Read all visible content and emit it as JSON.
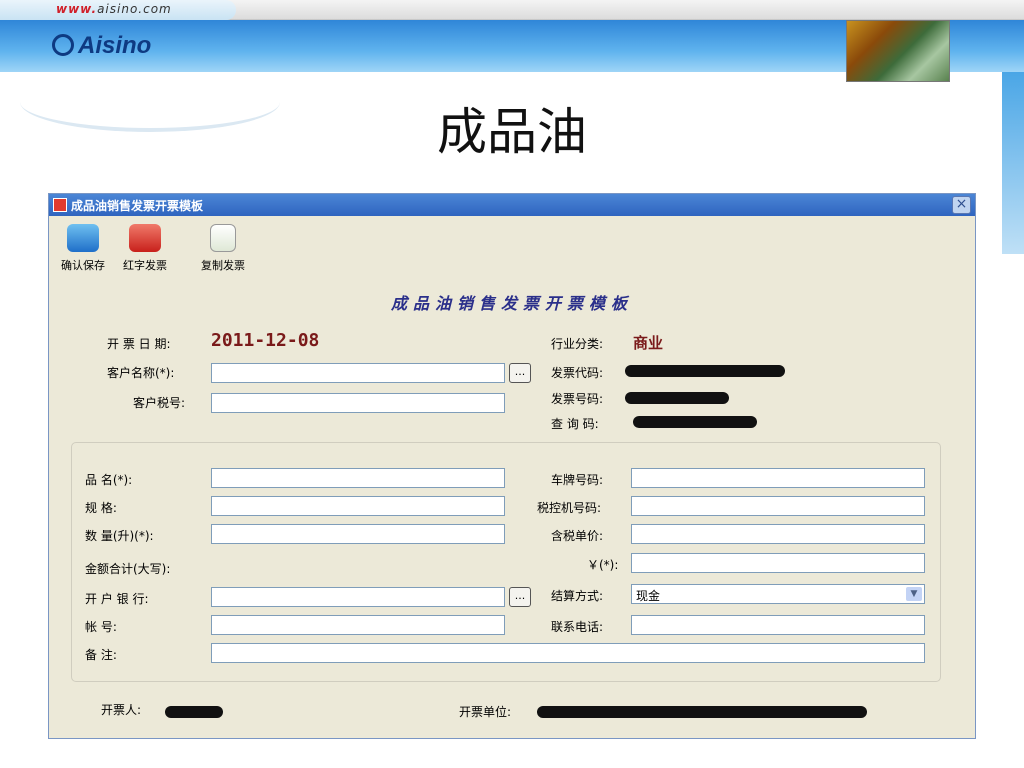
{
  "header": {
    "url_prefix": "www.",
    "url_rest": "aisino.com",
    "logo_text": "Aisino",
    "page_title": "成品油"
  },
  "window": {
    "title": "成品油销售发票开票模板",
    "close_glyph": "×"
  },
  "toolbar": {
    "save_label": "确认保存",
    "red_invoice_label": "红字发票",
    "copy_invoice_label": "复制发票"
  },
  "form": {
    "title": "成品油销售发票开票模板",
    "date_label": "开 票 日 期:",
    "date_value": "2011-12-08",
    "industry_label": "行业分类:",
    "industry_value": "商业",
    "customer_name_label": "客户名称(*):",
    "customer_name_value": "",
    "customer_tax_label": "客户税号:",
    "customer_tax_value": "",
    "invoice_code_label": "发票代码:",
    "invoice_number_label": "发票号码:",
    "query_code_label": "查 询 码:",
    "product_name_label": "品      名(*):",
    "product_name_value": "",
    "spec_label": "规          格:",
    "spec_value": "",
    "quantity_label": "数   量(升)(*):",
    "quantity_value": "",
    "amount_words_label": "金额合计(大写):",
    "bank_label": "开  户  银  行:",
    "bank_value": "",
    "account_label": "帐          号:",
    "account_value": "",
    "remark_label": "备          注:",
    "remark_value": "",
    "plate_label": "车牌号码:",
    "plate_value": "",
    "tax_machine_label": "税控机号码:",
    "tax_machine_value": "",
    "unit_price_label": "含税单价:",
    "unit_price_value": "",
    "yuan_label": "￥(*):",
    "yuan_value": "",
    "settlement_label": "结算方式:",
    "settlement_value": "现金",
    "phone_label": "联系电话:",
    "phone_value": "",
    "issuer_label": "开票人:",
    "issuer_unit_label": "开票单位:",
    "browse_glyph": "..."
  },
  "colors": {
    "title_bar": "#2f64bf",
    "form_bg": "#ece9d8",
    "accent_red": "#7a1a1a"
  }
}
